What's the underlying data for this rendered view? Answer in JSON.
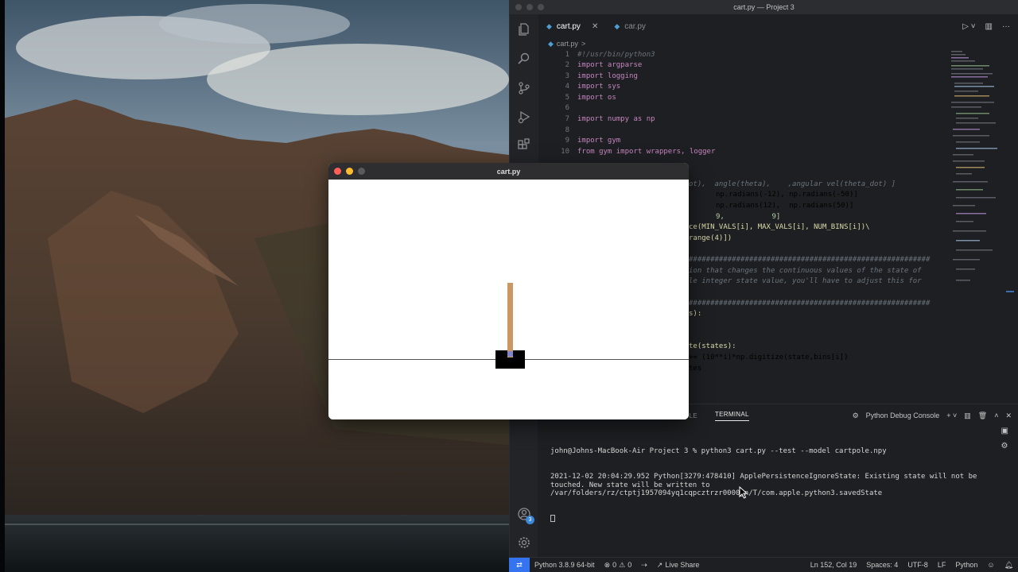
{
  "vscode": {
    "window_title": "cart.py — Project 3",
    "tabs": [
      {
        "label": "cart.py",
        "active": true
      },
      {
        "label": "car.py",
        "active": false
      }
    ],
    "breadcrumb": "cart.py",
    "breadcrumb_sep": ">",
    "lines": [
      {
        "n": "1",
        "code": "#!/usr/bin/python3"
      },
      {
        "n": "2",
        "code": "import argparse"
      },
      {
        "n": "3",
        "code": "import logging"
      },
      {
        "n": "4",
        "code": "import sys"
      },
      {
        "n": "5",
        "code": "import os"
      },
      {
        "n": "6",
        "code": ""
      },
      {
        "n": "7",
        "code": "import numpy as np"
      },
      {
        "n": "8",
        "code": ""
      },
      {
        "n": "9",
        "code": "import gym"
      },
      {
        "n": "10",
        "code": "from gym import wrappers, logger"
      }
    ],
    "visible_fragments": [
      "ot),  angle(theta),    ,angular vel(theta_dot) ]",
      "np.radians(-12), np.radians(-50)]",
      "np.radians(12),  np.radians(50)]",
      "9,           9]",
      "ce(MIN_VALS[i], MAX_VALS[i], NUM_BINS[i])\\",
      "range(4)])",
      "########################################################",
      "ion that changes the continuous values of the state of",
      "le integer state value, you'll have to adjust this for",
      "########################################################",
      "s):",
      "te(states):",
      "+= (10**i)*np.digitize(state,bins[i])",
      "tes"
    ],
    "panel": {
      "partial_tab": "OLE",
      "active_tab": "TERMINAL",
      "launch_profile": "Python Debug Console",
      "terminal_lines": [
        "john@Johns-MacBook-Air Project 3 % python3 cart.py --test --model cartpole.npy",
        "2021-12-02 20:04:29.952 Python[3279:478410] ApplePersistenceIgnoreState: Existing state will not be touched. New state will be written to /var/folders/rz/ctptj1957094yq1cqpcztrzr0000gn/T/com.apple.python3.savedState"
      ]
    },
    "statusbar": {
      "interpreter": "Python 3.8.9 64-bit",
      "errors": "0",
      "warnings": "0",
      "live_share": "Live Share",
      "position": "Ln 152, Col 19",
      "spaces": "Spaces: 4",
      "encoding": "UTF-8",
      "eol": "LF",
      "language": "Python"
    },
    "accounts_badge": "3",
    "colors": {
      "accent": "#3574f0",
      "python_blue": "#4e9ed6"
    }
  },
  "game_window": {
    "title": "cart.py",
    "colors": {
      "cart": "#000000",
      "pole": "#ca9865",
      "axle": "#8184cb",
      "track": "#555555"
    }
  },
  "icons": [
    "explorer-icon",
    "search-icon",
    "source-control-icon",
    "run-debug-icon",
    "extensions-icon",
    "accounts-icon",
    "settings-gear-icon",
    "run-icon",
    "split-editor-icon",
    "more-icon"
  ]
}
